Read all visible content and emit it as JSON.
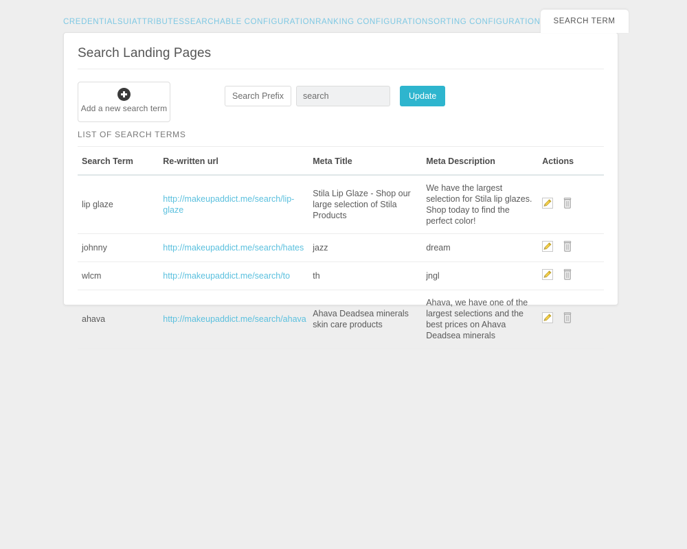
{
  "tabs": [
    {
      "label": "CREDENTIALS",
      "active": false
    },
    {
      "label": "UI",
      "active": false
    },
    {
      "label": "ATTRIBUTES",
      "active": false
    },
    {
      "label": "SEARCHABLE CONFIGURATION",
      "active": false
    },
    {
      "label": "RANKING CONFIGURATION",
      "active": false
    },
    {
      "label": "SORTING CONFIGURATION",
      "active": false
    },
    {
      "label": "SEARCH TERM",
      "active": true
    }
  ],
  "page_title": "Search Landing Pages",
  "toolbar": {
    "add_button_label": "Add a new search term",
    "add_icon": "plus-circle-icon",
    "prefix_label": "Search Prefix",
    "prefix_value": "search",
    "prefix_placeholder": "search",
    "update_label": "Update",
    "update_color": "#2eb5ce"
  },
  "list_heading": "LIST OF SEARCH TERMS",
  "table": {
    "columns": [
      "Search Term",
      "Re-written url",
      "Meta Title",
      "Meta Description",
      "Actions"
    ],
    "rows": [
      {
        "term": "lip glaze",
        "url": "http://makeupaddict.me/search/lip-glaze",
        "meta_title": "Stila Lip Glaze - Shop our large selection of Stila Products",
        "meta_description": "We have the largest selection for Stila lip glazes. Shop today to find the perfect color!"
      },
      {
        "term": "johnny",
        "url": "http://makeupaddict.me/search/hates",
        "meta_title": "jazz",
        "meta_description": "dream"
      },
      {
        "term": "wlcm",
        "url": "http://makeupaddict.me/search/to",
        "meta_title": "th",
        "meta_description": "jngl"
      },
      {
        "term": "ahava",
        "url": "http://makeupaddict.me/search/ahava",
        "meta_title": "Ahava Deadsea minerals skin care products",
        "meta_description": "Ahava, we have one of the largest selections and the best prices on Ahava Deadsea minerals"
      }
    ],
    "action_icons": {
      "edit": "edit-pencil-icon",
      "delete": "trash-icon"
    },
    "link_color": "#5bc0de"
  }
}
